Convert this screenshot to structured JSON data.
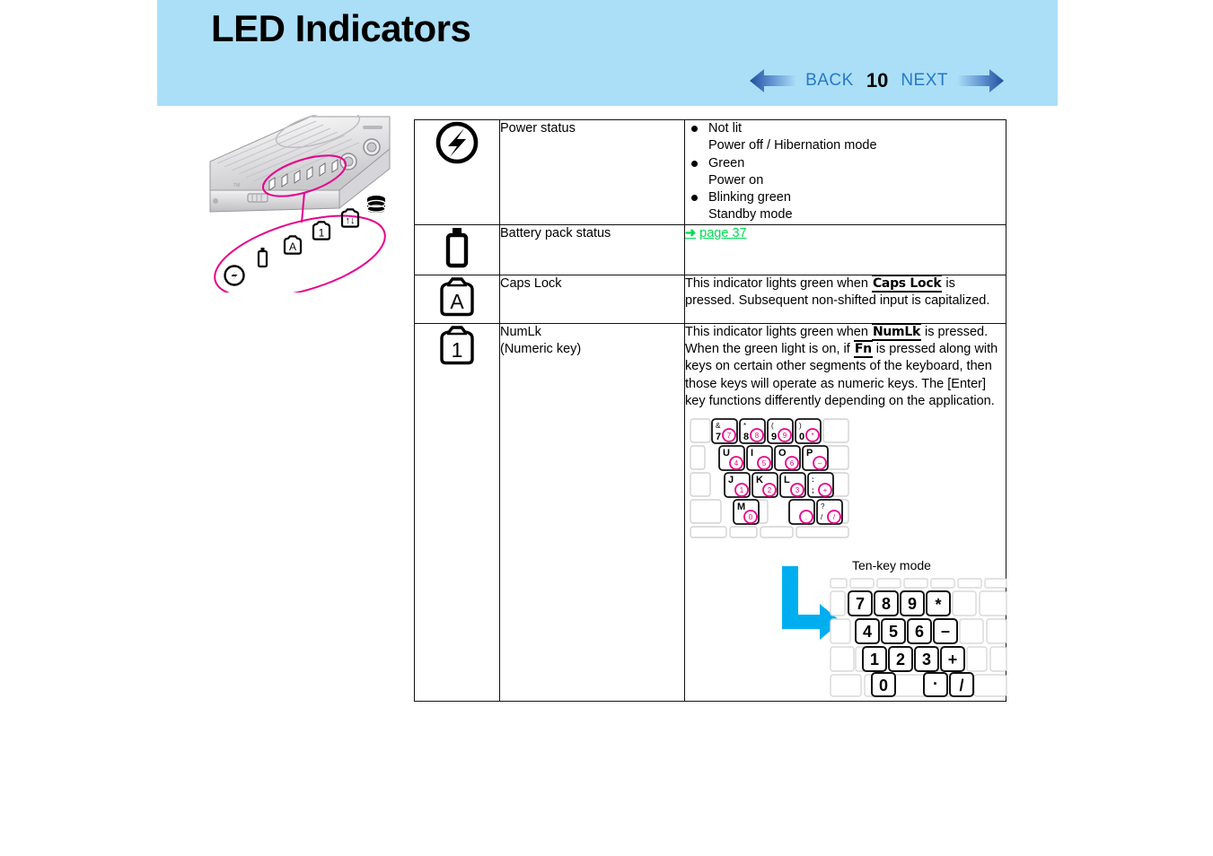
{
  "header": {
    "title": "LED Indicators",
    "nav": {
      "back_label": "BACK",
      "page_number": "10",
      "next_label": "NEXT",
      "back_icon": "arrow-left-icon",
      "next_icon": "arrow-right-icon",
      "link_color": "#2878C8"
    },
    "background_color": "#ABDFF7"
  },
  "illustration": {
    "name": "laptop-led-indicator-callout",
    "callout_color": "#E8008C",
    "icons": [
      "power-icon",
      "battery-icon",
      "caps-lock-icon",
      "numlk-icon",
      "scroll-lock-icon",
      "hdd-icon"
    ]
  },
  "table": {
    "rows": [
      {
        "icon": "power-status-icon",
        "name": "Power status",
        "desc_type": "bullets",
        "bullets": [
          {
            "label": "Not lit",
            "sub": "Power off / Hibernation mode"
          },
          {
            "label": "Green",
            "sub": "Power on"
          },
          {
            "label": "Blinking green",
            "sub": "Standby mode"
          }
        ]
      },
      {
        "icon": "battery-status-icon",
        "name": "Battery pack status",
        "desc_type": "link",
        "link": {
          "arrow": "➜",
          "text": "page 37",
          "color": "#00DC53"
        }
      },
      {
        "icon": "caps-lock-indicator-icon",
        "name": "Caps Lock",
        "desc_type": "text",
        "text_parts": [
          {
            "t": "This indicator lights green when ",
            "style": "plain"
          },
          {
            "t": "Caps Lock",
            "style": "keycap"
          },
          {
            "t": " is pressed. Subsequent non-shifted input is capitalized.",
            "style": "plain"
          }
        ]
      },
      {
        "icon": "numlk-indicator-icon",
        "name": "NumLk",
        "name_sub": "(Numeric key)",
        "desc_type": "text-with-diagram",
        "text_parts": [
          {
            "t": "This indicator lights green when ",
            "style": "plain"
          },
          {
            "t": "NumLk",
            "style": "keycap"
          },
          {
            "t": " is pressed. When the green light is on, if ",
            "style": "plain"
          },
          {
            "t": "Fn",
            "style": "keycap"
          },
          {
            "t": " is pressed along with keys on certain other segments of the keyboard, then those keys will operate as numeric keys. The [Enter] key functions differently depending on the application.",
            "style": "plain"
          }
        ],
        "keyboard_overlay": {
          "highlight_color": "#E8008C",
          "rows": [
            [
              {
                "top": "&",
                "main": "7",
                "num": "7"
              },
              {
                "top": "*",
                "main": "8",
                "num": "8"
              },
              {
                "top": "(",
                "main": "9",
                "num": "9"
              },
              {
                "top": ")",
                "main": "0",
                "num": "*"
              }
            ],
            [
              {
                "top": "",
                "main": "U",
                "num": "4"
              },
              {
                "top": "",
                "main": "I",
                "num": "5"
              },
              {
                "top": "",
                "main": "O",
                "num": "6"
              },
              {
                "top": "",
                "main": "P",
                "num": "–"
              }
            ],
            [
              {
                "top": "",
                "main": "J",
                "num": "1"
              },
              {
                "top": "",
                "main": "K",
                "num": "2"
              },
              {
                "top": "",
                "main": "L",
                "num": "3"
              },
              {
                "top": ":",
                "main": ";",
                "num": "+"
              }
            ],
            [
              {
                "top": "",
                "main": "M",
                "num": "0"
              },
              {
                "top": "",
                "main": "",
                "num": "."
              },
              {
                "top": "?",
                "main": "/",
                "num": "/"
              }
            ]
          ]
        },
        "tenkey": {
          "label": "Ten-key mode",
          "arrow_color": "#00AEEF",
          "rows": [
            [
              "7",
              "8",
              "9",
              "*"
            ],
            [
              "4",
              "5",
              "6",
              "–"
            ],
            [
              "1",
              "2",
              "3",
              "+"
            ],
            [
              "0",
              "·",
              "/"
            ]
          ]
        }
      }
    ]
  }
}
